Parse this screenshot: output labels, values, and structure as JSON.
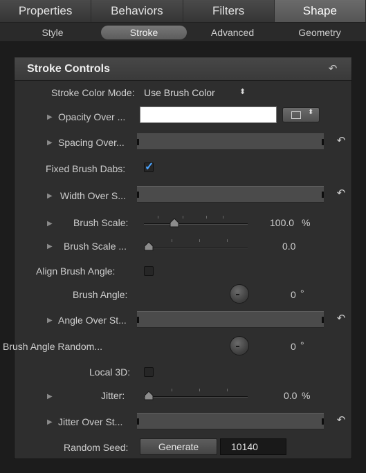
{
  "top_tabs": [
    {
      "label": "Properties",
      "active": false
    },
    {
      "label": "Behaviors",
      "active": false
    },
    {
      "label": "Filters",
      "active": false
    },
    {
      "label": "Shape",
      "active": true
    }
  ],
  "sub_tabs": [
    {
      "label": "Style",
      "active": false
    },
    {
      "label": "Stroke",
      "active": true
    },
    {
      "label": "Advanced",
      "active": false
    },
    {
      "label": "Geometry",
      "active": false
    }
  ],
  "panel": {
    "title": "Stroke Controls",
    "rows": {
      "stroke_color_mode": {
        "label": "Stroke Color Mode:",
        "value": "Use Brush Color",
        "arrows": "⬍"
      },
      "opacity_over": {
        "label": "Opacity Over ...",
        "color": "#ffffff"
      },
      "spacing_over": {
        "label": "Spacing Over..."
      },
      "fixed_brush_dabs": {
        "label": "Fixed Brush Dabs:",
        "checked": true,
        "check_glyph": "✓"
      },
      "width_over": {
        "label": "Width Over S..."
      },
      "brush_scale": {
        "label": "Brush Scale:",
        "value": "100.0",
        "unit": "%",
        "level": 0.27
      },
      "brush_scale_rand": {
        "label": "Brush Scale ...",
        "value": "0.0",
        "level": 0.0
      },
      "align_brush_angle": {
        "label": "Align Brush Angle:",
        "checked": false
      },
      "brush_angle": {
        "label": "Brush Angle:",
        "value": "0",
        "unit": "°"
      },
      "angle_over": {
        "label": "Angle Over St..."
      },
      "brush_angle_random": {
        "label": "Brush Angle Random...",
        "value": "0",
        "unit": "°"
      },
      "local_3d": {
        "label": "Local 3D:",
        "checked": false
      },
      "jitter": {
        "label": "Jitter:",
        "value": "0.0",
        "unit": "%",
        "level": 0.0
      },
      "jitter_over": {
        "label": "Jitter Over St..."
      },
      "random_seed": {
        "label": "Random Seed:",
        "button": "Generate",
        "value": "10140"
      }
    }
  },
  "icons": {
    "reset": "↶",
    "disclosure": "▶",
    "popup_arrows": "⬍"
  },
  "colors": {
    "accent": "#4aa3ff",
    "panel_bg": "#2e2e2e",
    "app_bg": "#1c1c1c"
  }
}
